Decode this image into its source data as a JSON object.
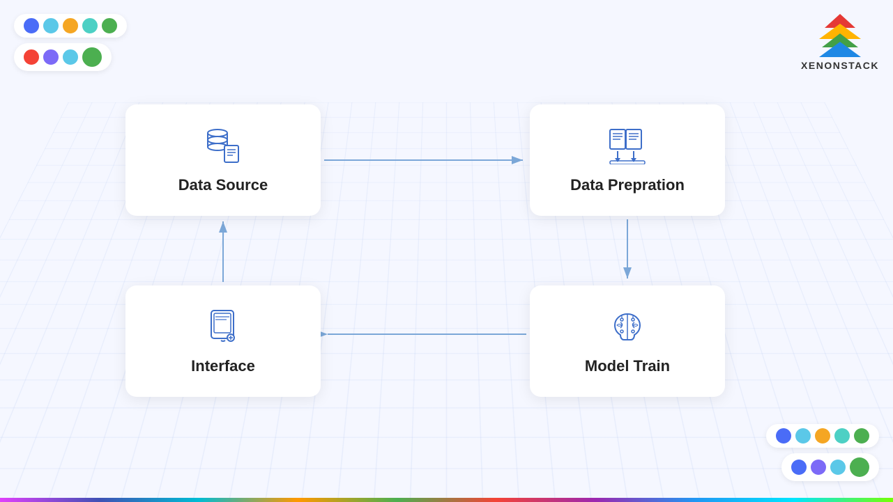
{
  "logo": {
    "label": "XENONSTACK"
  },
  "decorators": {
    "top_row1": [
      {
        "color": "#4a6cf7",
        "id": "d1"
      },
      {
        "color": "#5bc8e8",
        "id": "d2"
      },
      {
        "color": "#f5a623",
        "id": "d3"
      },
      {
        "color": "#4dd0c4",
        "id": "d4"
      },
      {
        "color": "#4caf50",
        "id": "d5"
      }
    ],
    "top_row2": [
      {
        "color": "#f44336",
        "id": "d6"
      },
      {
        "color": "#7c6af7",
        "id": "d7"
      },
      {
        "color": "#5bc8e8",
        "id": "d8"
      },
      {
        "color": "#4caf50",
        "id": "d9"
      }
    ],
    "bottom_row1": [
      {
        "color": "#4a6cf7",
        "id": "db1"
      },
      {
        "color": "#5bc8e8",
        "id": "db2"
      },
      {
        "color": "#f5a623",
        "id": "db3"
      },
      {
        "color": "#4dd0c4",
        "id": "db4"
      },
      {
        "color": "#4caf50",
        "id": "db5"
      }
    ],
    "bottom_row2": [
      {
        "color": "#4a6cf7",
        "id": "db6"
      },
      {
        "color": "#7c6af7",
        "id": "db7"
      },
      {
        "color": "#5bc8e8",
        "id": "db8"
      },
      {
        "color": "#4caf50",
        "id": "db9"
      }
    ]
  },
  "diagram": {
    "boxes": [
      {
        "id": "datasource",
        "label": "Data Source",
        "icon": "database"
      },
      {
        "id": "dataprep",
        "label": "Data Prepration",
        "icon": "documents"
      },
      {
        "id": "interface",
        "label": "Interface",
        "icon": "tablet"
      },
      {
        "id": "modeltrain",
        "label": "Model Train",
        "icon": "brain"
      }
    ]
  }
}
